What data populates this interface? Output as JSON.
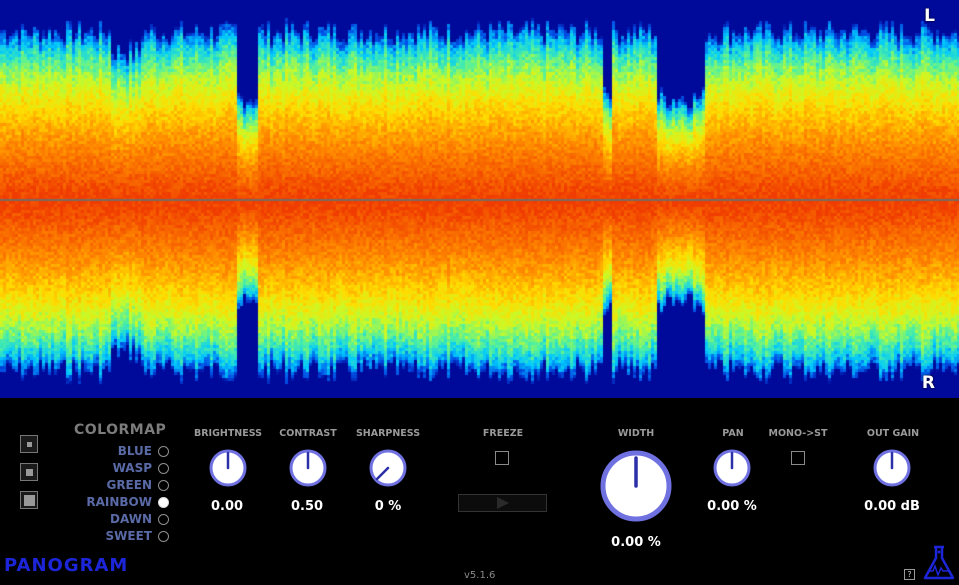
{
  "channels": {
    "left": "L",
    "right": "R"
  },
  "colormap": {
    "title": "COLORMAP",
    "options": [
      "BLUE",
      "WASP",
      "GREEN",
      "RAINBOW",
      "DAWN",
      "SWEET"
    ],
    "selected": "RAINBOW"
  },
  "view_size_buttons": [
    "small-view",
    "medium-view",
    "large-view"
  ],
  "params": {
    "brightness": {
      "label": "BRIGHTNESS",
      "value": "0.00"
    },
    "contrast": {
      "label": "CONTRAST",
      "value": "0.50"
    },
    "sharpness": {
      "label": "SHARPNESS",
      "value": "0 %"
    },
    "freeze": {
      "label": "FREEZE",
      "checked": false
    },
    "width": {
      "label": "WIDTH",
      "value": "0.00 %"
    },
    "pan": {
      "label": "PAN",
      "value": "0.00 %"
    },
    "mono_to_st": {
      "label": "MONO->ST",
      "checked": false
    },
    "out_gain": {
      "label": "OUT GAIN",
      "value": "0.00 dB"
    }
  },
  "footer": {
    "logo": "PANOGRAM",
    "version": "v5.1.6",
    "help": "?"
  },
  "colors": {
    "background": "#000000",
    "spectrum_background": "#000a9a",
    "knob_ring": "#6f71e0",
    "knob_face": "#ffffff",
    "logo": "#1c26d8",
    "center_line": "#7a6a60"
  }
}
